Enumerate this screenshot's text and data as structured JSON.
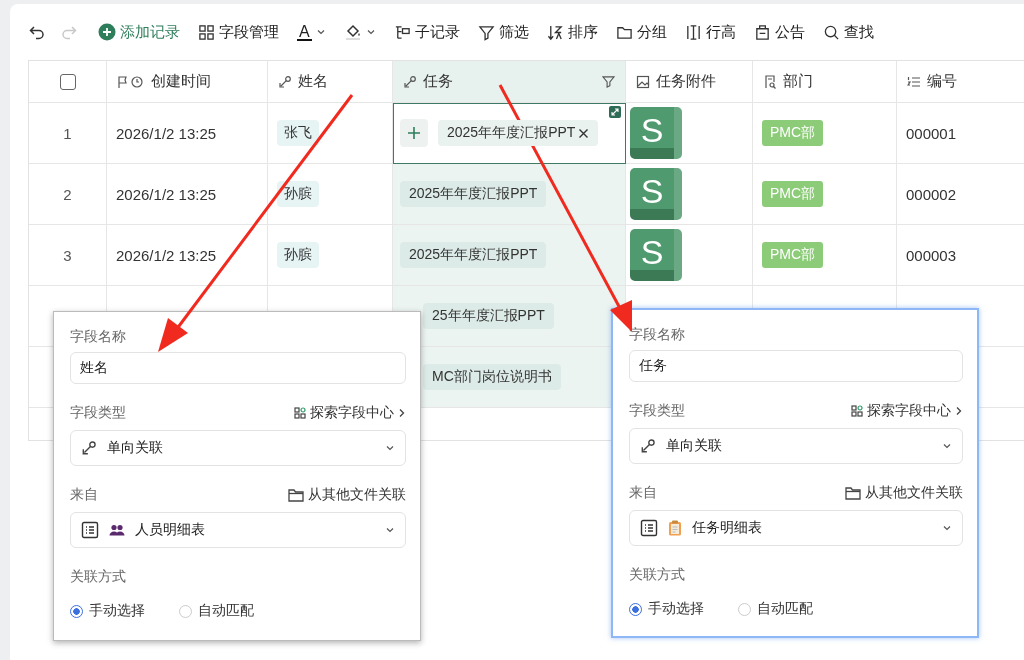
{
  "toolbar": {
    "undo": {
      "disabled": false
    },
    "redo": {
      "disabled": true
    },
    "buttons": [
      {
        "label": "添加记录",
        "kind": "add"
      },
      {
        "label": "字段管理",
        "kind": "plain"
      },
      {
        "label": "A",
        "kind": "text-color"
      },
      {
        "kind": "fill-color"
      },
      {
        "label": "子记录",
        "kind": "plain"
      },
      {
        "label": "筛选",
        "kind": "plain"
      },
      {
        "label": "排序",
        "kind": "plain"
      },
      {
        "label": "分组",
        "kind": "plain"
      },
      {
        "label": "行高",
        "kind": "plain"
      },
      {
        "label": "公告",
        "kind": "plain"
      },
      {
        "label": "查找",
        "kind": "plain"
      }
    ]
  },
  "table": {
    "columns": [
      {
        "selected": false
      },
      {
        "label": "创建时间",
        "selected": false
      },
      {
        "label": "姓名",
        "selected": false
      },
      {
        "label": "任务",
        "selected": true
      },
      {
        "label": "任务附件",
        "selected": false
      },
      {
        "label": "部门",
        "selected": false
      },
      {
        "label": "编号",
        "selected": false
      }
    ],
    "rows": [
      {
        "index": "1",
        "created": "2026/1/2 13:25",
        "name": "张飞",
        "task": "2025年年度汇报PPT",
        "editing": true,
        "attachment": "S",
        "dept": "PMC部",
        "number": "000001"
      },
      {
        "index": "2",
        "created": "2026/1/2 13:25",
        "name": "孙膑",
        "task": "2025年年度汇报PPT",
        "editing": false,
        "attachment": "S",
        "dept": "PMC部",
        "number": "000002"
      },
      {
        "index": "3",
        "created": "2026/1/2 13:25",
        "name": "孙膑",
        "task": "2025年年度汇报PPT",
        "editing": false,
        "attachment": "S",
        "dept": "PMC部",
        "number": "000003"
      },
      {
        "task": "25年年度汇报PPT",
        "editing": false
      },
      {
        "task": "MC部门岗位说明书",
        "editing": false
      }
    ]
  },
  "panels": [
    {
      "focused": false,
      "name_label": "字段名称",
      "name_value": "姓名",
      "type_label": "字段类型",
      "explore_link": "探索字段中心",
      "type_value": "单向关联",
      "source_label": "来自",
      "other_file_link": "从其他文件关联",
      "source_value": "人员明细表",
      "mode_label": "关联方式",
      "options": [
        {
          "label": "手动选择",
          "selected": true
        },
        {
          "label": "自动匹配",
          "selected": false
        }
      ]
    },
    {
      "focused": true,
      "name_label": "字段名称",
      "name_value": "任务",
      "type_label": "字段类型",
      "explore_link": "探索字段中心",
      "type_value": "单向关联",
      "source_label": "来自",
      "other_file_link": "从其他文件关联",
      "source_value": "任务明细表",
      "mode_label": "关联方式",
      "options": [
        {
          "label": "手动选择",
          "selected": true
        },
        {
          "label": "自动匹配",
          "selected": false
        }
      ]
    }
  ]
}
